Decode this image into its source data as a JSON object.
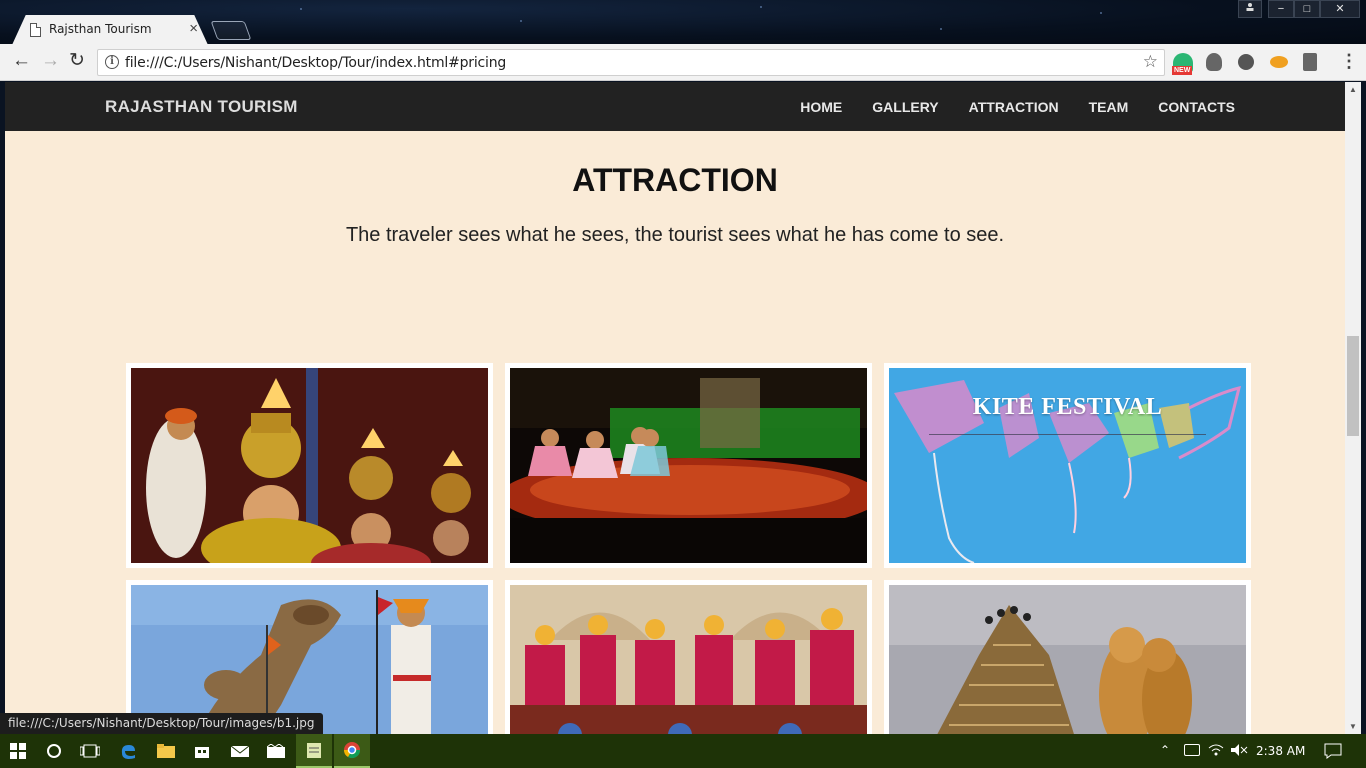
{
  "browser": {
    "tab_title": "Rajsthan Tourism",
    "tab_close": "×",
    "url": "file:///C:/Users/Nishant/Desktop/Tour/index.html#pricing",
    "window_controls": [
      "−",
      "□",
      "✕"
    ],
    "extension_badge": "NEW",
    "status_url": "file:///C:/Users/Nishant/Desktop/Tour/images/b1.jpg"
  },
  "site": {
    "brand": "RAJASTHAN TOURISM",
    "nav": [
      "HOME",
      "GALLERY",
      "ATTRACTION",
      "TEAM",
      "CONTACTS"
    ],
    "section_title": "ATTRACTION",
    "section_subtitle": "The traveler sees what he sees, the tourist sees what he has come to see.",
    "gallery": [
      {
        "name": "fire-pot-dancers"
      },
      {
        "name": "stage-dancers"
      },
      {
        "name": "kite-festival",
        "caption": "KITE FESTIVAL"
      },
      {
        "name": "camel-parade"
      },
      {
        "name": "gangaur-idols"
      },
      {
        "name": "sand-sculpture"
      }
    ]
  },
  "taskbar": {
    "clock": "2:38 AM",
    "icons": [
      "start-icon",
      "cortana-icon",
      "task-view-icon",
      "edge-icon",
      "file-explorer-icon",
      "store-icon",
      "mail-icon",
      "movies-icon",
      "notepad-icon",
      "chrome-icon"
    ]
  },
  "colors": {
    "page_bg": "#faebd7",
    "nav_bg": "#222222",
    "taskbar_bg": "#1e3307"
  }
}
